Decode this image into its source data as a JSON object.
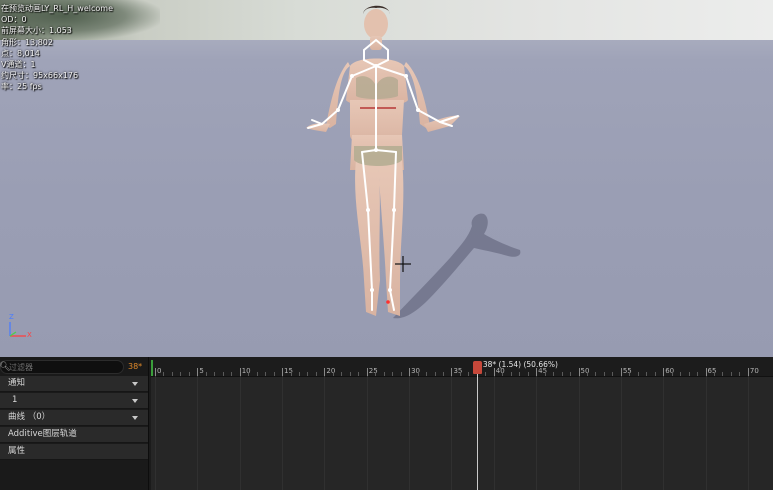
{
  "viewport": {
    "stats": [
      "在预览动画LY_RL_H_welcome",
      "OD：0",
      "前屏幕大小：1.053",
      "角形：13,802",
      "点：8,014",
      "V通道：1",
      "约尺寸：95x66x176",
      "率：25 fps"
    ],
    "gizmo": {
      "z_label": "Z",
      "x_label": "X"
    }
  },
  "sequencer": {
    "filter_placeholder": "过滤器",
    "current_frame_badge": "38*",
    "tracks": [
      {
        "label": "通知",
        "expandable": true
      },
      {
        "label": "1",
        "expandable": true
      },
      {
        "label": "曲线 （0）",
        "expandable": true
      },
      {
        "label": "Additive图层轨道",
        "expandable": false
      },
      {
        "label": "属性",
        "expandable": false
      }
    ],
    "ruler": {
      "start": 0,
      "end": 70,
      "major_step": 5,
      "labels": [
        "0",
        "5",
        "10",
        "15",
        "20",
        "25",
        "30",
        "35",
        "40",
        "45",
        "50",
        "55",
        "60",
        "65",
        "70"
      ]
    },
    "playhead": {
      "frame": 38,
      "label": "38* (1.54) (50.66%)"
    }
  },
  "colors": {
    "playhead": "#c6483a",
    "frame_badge": "#e08a2a",
    "skeleton": "#ffffff",
    "viewport_bg": "#9a9eb4"
  }
}
